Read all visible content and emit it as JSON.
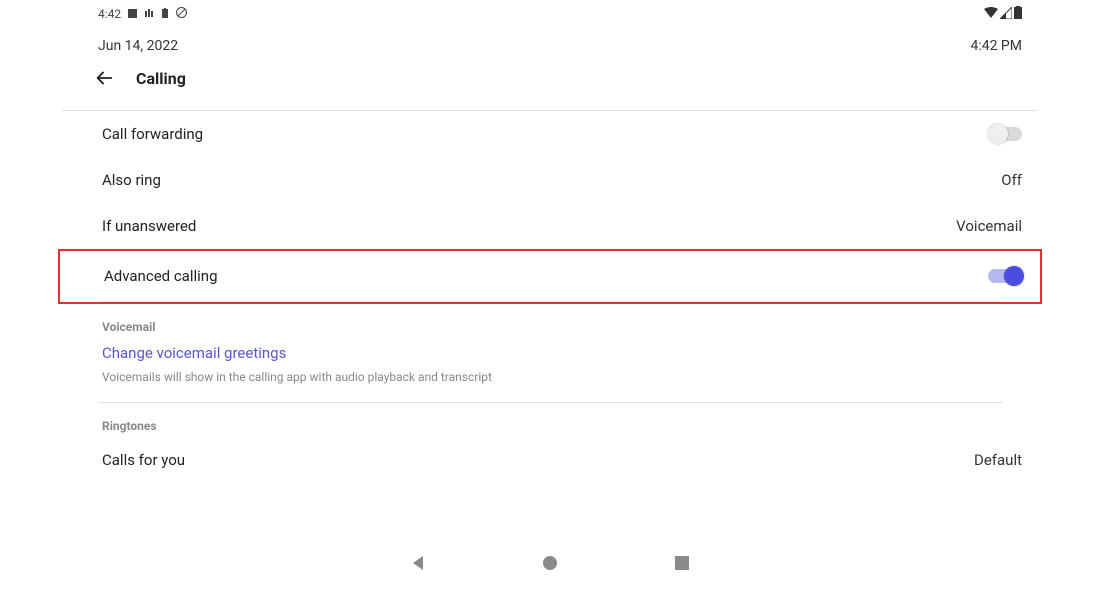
{
  "status": {
    "time_small": "4:42",
    "date": "Jun 14, 2022",
    "time_right": "4:42 PM"
  },
  "header": {
    "title": "Calling"
  },
  "rows": {
    "call_forwarding": {
      "label": "Call forwarding",
      "toggle_on": false
    },
    "also_ring": {
      "label": "Also ring",
      "value": "Off"
    },
    "if_unanswered": {
      "label": "If unanswered",
      "value": "Voicemail"
    },
    "advanced_calling": {
      "label": "Advanced calling",
      "toggle_on": true
    }
  },
  "voicemail_section": {
    "header": "Voicemail",
    "link": "Change voicemail greetings",
    "help": "Voicemails will show in the calling app with audio playback and transcript"
  },
  "ringtones_section": {
    "header": "Ringtones",
    "calls_for_you": {
      "label": "Calls for you",
      "value": "Default"
    }
  },
  "colors": {
    "accent": "#4a4de0",
    "highlight": "#e0322e",
    "link": "#5558cf"
  }
}
